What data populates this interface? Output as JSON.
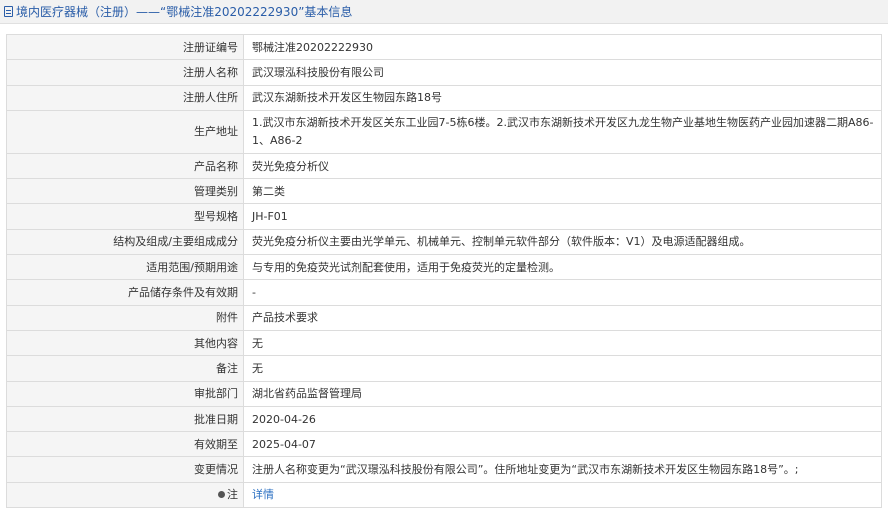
{
  "header": {
    "icon": "document-icon",
    "title": "境内医疗器械（注册）——“鄂械注准20202222930”基本信息"
  },
  "rows": [
    {
      "label": "注册证编号",
      "value": "鄂械注准20202222930"
    },
    {
      "label": "注册人名称",
      "value": "武汉璟泓科技股份有限公司"
    },
    {
      "label": "注册人住所",
      "value": "武汉东湖新技术开发区生物园东路18号"
    },
    {
      "label": "生产地址",
      "value": "1.武汉市东湖新技术开发区关东工业园7-5栋6楼。2.武汉市东湖新技术开发区九龙生物产业基地生物医药产业园加速器二期A86-1、A86-2"
    },
    {
      "label": "产品名称",
      "value": "荧光免疫分析仪"
    },
    {
      "label": "管理类别",
      "value": "第二类"
    },
    {
      "label": "型号规格",
      "value": "JH-F01"
    },
    {
      "label": "结构及组成/主要组成成分",
      "value": "荧光免疫分析仪主要由光学单元、机械单元、控制单元软件部分（软件版本：V1）及电源适配器组成。"
    },
    {
      "label": "适用范围/预期用途",
      "value": "与专用的免疫荧光试剂配套使用，适用于免疫荧光的定量检测。"
    },
    {
      "label": "产品储存条件及有效期",
      "value": "-"
    },
    {
      "label": "附件",
      "value": "产品技术要求"
    },
    {
      "label": "其他内容",
      "value": "无"
    },
    {
      "label": "备注",
      "value": "无"
    },
    {
      "label": "审批部门",
      "value": "湖北省药品监督管理局"
    },
    {
      "label": "批准日期",
      "value": "2020-04-26"
    },
    {
      "label": "有效期至",
      "value": "2025-04-07"
    },
    {
      "label": "变更情况",
      "value": "注册人名称变更为“武汉璟泓科技股份有限公司”。住所地址变更为“武汉市东湖新技术开发区生物园东路18号”。;"
    }
  ],
  "note_row": {
    "icon": "pin-icon",
    "label": "注",
    "link_text": "详情",
    "link_color": "#2a6fc2"
  }
}
